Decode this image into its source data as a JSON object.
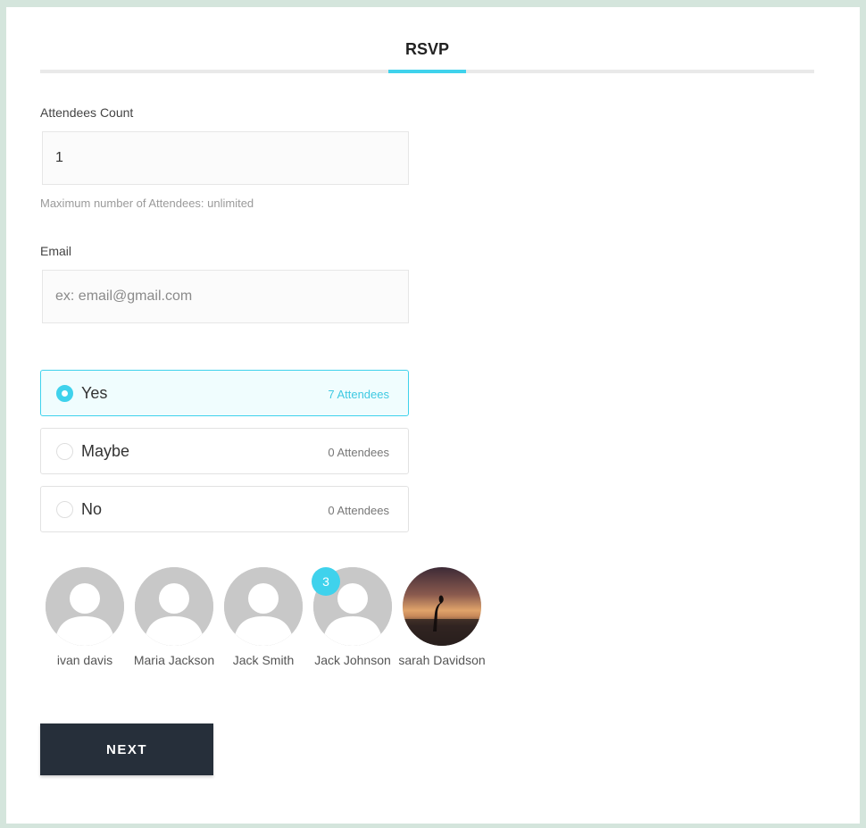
{
  "header": {
    "tab_title": "RSVP"
  },
  "attendees_count": {
    "label": "Attendees Count",
    "value": "1",
    "hint": "Maximum number of Attendees: unlimited"
  },
  "email": {
    "label": "Email",
    "placeholder": "ex: email@gmail.com"
  },
  "rsvp_options": [
    {
      "label": "Yes",
      "count": "7 Attendees",
      "selected": true
    },
    {
      "label": "Maybe",
      "count": "0 Attendees",
      "selected": false
    },
    {
      "label": "No",
      "count": "0 Attendees",
      "selected": false
    }
  ],
  "attendees": [
    {
      "name": "ivan davis",
      "avatar": "default-avatar-icon"
    },
    {
      "name": "Maria Jackson",
      "avatar": "default-avatar-icon"
    },
    {
      "name": "Jack Smith",
      "avatar": "default-avatar-icon"
    },
    {
      "name": "Jack Johnson",
      "avatar": "default-avatar-icon",
      "badge": "3"
    },
    {
      "name": "sarah Davidson",
      "avatar": "sunset-photo"
    }
  ],
  "next_button": {
    "label": "NEXT"
  },
  "colors": {
    "accent": "#3fd2ec",
    "button_bg": "#262f3a",
    "page_bg": "#d4e5dc"
  }
}
